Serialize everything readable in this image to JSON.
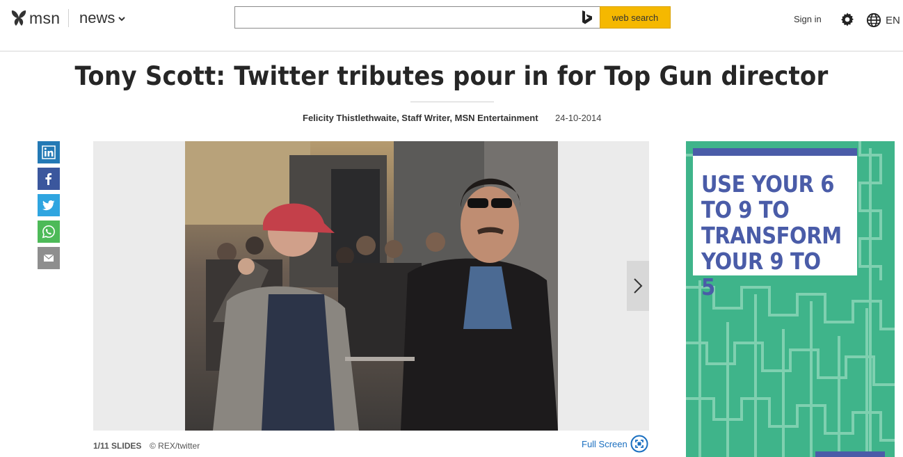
{
  "header": {
    "brand": "msn",
    "section": "news",
    "search": {
      "value": "",
      "placeholder": "",
      "button_label": "web search"
    },
    "sign_in": "Sign in",
    "language": "EN"
  },
  "article": {
    "title": "Tony Scott: Twitter tributes pour in for Top Gun director",
    "byline": "Felicity Thistlethwaite, Staff Writer, MSN Entertainment",
    "date": "24-10-2014"
  },
  "share": [
    {
      "network": "LinkedIn",
      "icon": "linkedin-icon",
      "color": "#2379b5"
    },
    {
      "network": "Facebook",
      "icon": "facebook-icon",
      "color": "#3b579d"
    },
    {
      "network": "Twitter",
      "icon": "twitter-icon",
      "color": "#2fa5e0"
    },
    {
      "network": "WhatsApp",
      "icon": "whatsapp-icon",
      "color": "#4dba58"
    },
    {
      "network": "Email",
      "icon": "email-icon",
      "color": "#8e8e8e"
    }
  ],
  "slideshow": {
    "counter": "1/11 SLIDES",
    "credit": "© REX/twitter",
    "fullscreen_label": "Full Screen",
    "current_slide": 1,
    "total_slides": 11
  },
  "ad": {
    "text": "USE YOUR 6 TO 9 TO TRANSFORM YOUR 9 TO 5",
    "background_color": "#3fb48a",
    "accent_color": "#4a5ca8"
  },
  "colors": {
    "search_button": "#f5b800",
    "link": "#1a6fc0"
  }
}
